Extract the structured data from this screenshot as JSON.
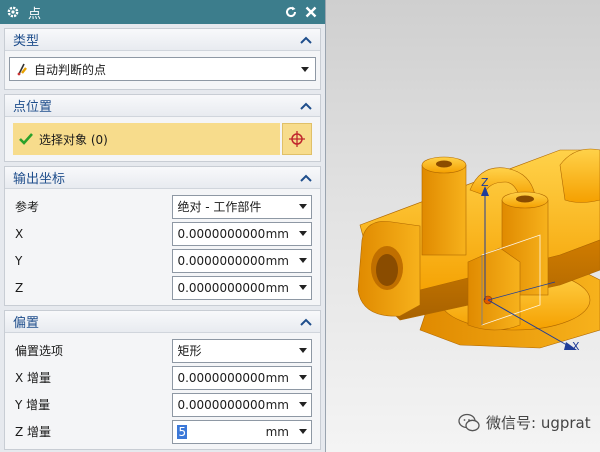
{
  "window": {
    "title": "点"
  },
  "type_group": {
    "header": "类型",
    "selection": "自动判断的点"
  },
  "location_group": {
    "header": "点位置",
    "select_object": "选择对象 (0)"
  },
  "coords_group": {
    "header": "输出坐标",
    "reference": {
      "label": "参考",
      "value": "绝对 - 工作部件"
    },
    "rows": [
      {
        "label": "X",
        "value": "0.0000000000",
        "unit": "mm"
      },
      {
        "label": "Y",
        "value": "0.0000000000",
        "unit": "mm"
      },
      {
        "label": "Z",
        "value": "0.0000000000",
        "unit": "mm"
      }
    ]
  },
  "offset_group": {
    "header": "偏置",
    "option": {
      "label": "偏置选项",
      "value": "矩形"
    },
    "rows": [
      {
        "label": "X 增量",
        "value": "0.0000000000",
        "unit": "mm"
      },
      {
        "label": "Y 增量",
        "value": "0.0000000000",
        "unit": "mm"
      },
      {
        "label": "Z 增量",
        "value": "5",
        "unit": "mm"
      }
    ]
  },
  "viewport": {
    "axis_z": "Z",
    "axis_x": "X",
    "watermark": "微信号: ugprat",
    "part_color": "#f5a000"
  }
}
